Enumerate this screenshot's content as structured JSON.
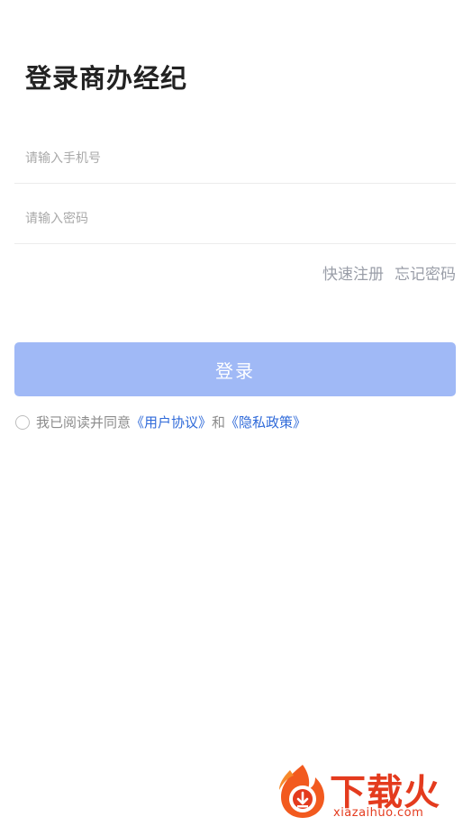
{
  "header": {
    "title": "登录商办经纪"
  },
  "form": {
    "phone_placeholder": "请输入手机号",
    "password_placeholder": "请输入密码",
    "quick_register": "快速注册",
    "forgot_password": "忘记密码",
    "login_label": "登录"
  },
  "agreement": {
    "prefix": "我已阅读并同意",
    "user_agreement": "《用户协议》",
    "conjunction": "和",
    "privacy_policy": "《隐私政策》",
    "checked": false
  },
  "watermark": {
    "brand": "下载火",
    "domain": "xiazaihuo.com"
  },
  "colors": {
    "primary_button": "#a0b9f6",
    "link_blue": "#2f6ad9",
    "muted_link": "#9a9ea8",
    "watermark": "#e43b1e"
  }
}
